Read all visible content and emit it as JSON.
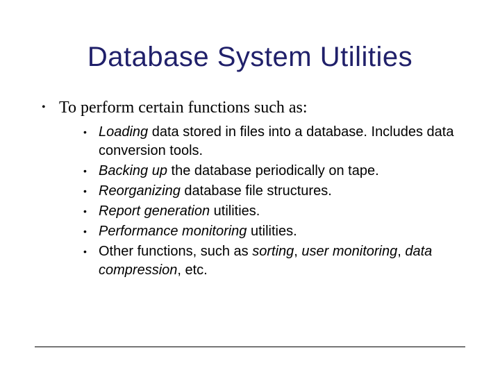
{
  "title": "Database System Utilities",
  "lead": "To perform certain functions such as:",
  "items": {
    "i0": {
      "em": "Loading",
      "rest": " data stored in files into a database. Includes data conversion tools."
    },
    "i1": {
      "em": "Backing up",
      "rest": " the database periodically on tape."
    },
    "i2": {
      "em": "Reorganizing",
      "rest": " database file structures."
    },
    "i3": {
      "em": "Report generation",
      "rest": " utilities."
    },
    "i4": {
      "em": "Performance monitoring",
      "rest": " utilities."
    },
    "i5": {
      "pre": "Other functions, such as ",
      "em1": "sorting",
      "mid1": ", ",
      "em2": "user monitoring",
      "mid2": ", ",
      "em3": "data compression",
      "post": ", etc."
    }
  }
}
